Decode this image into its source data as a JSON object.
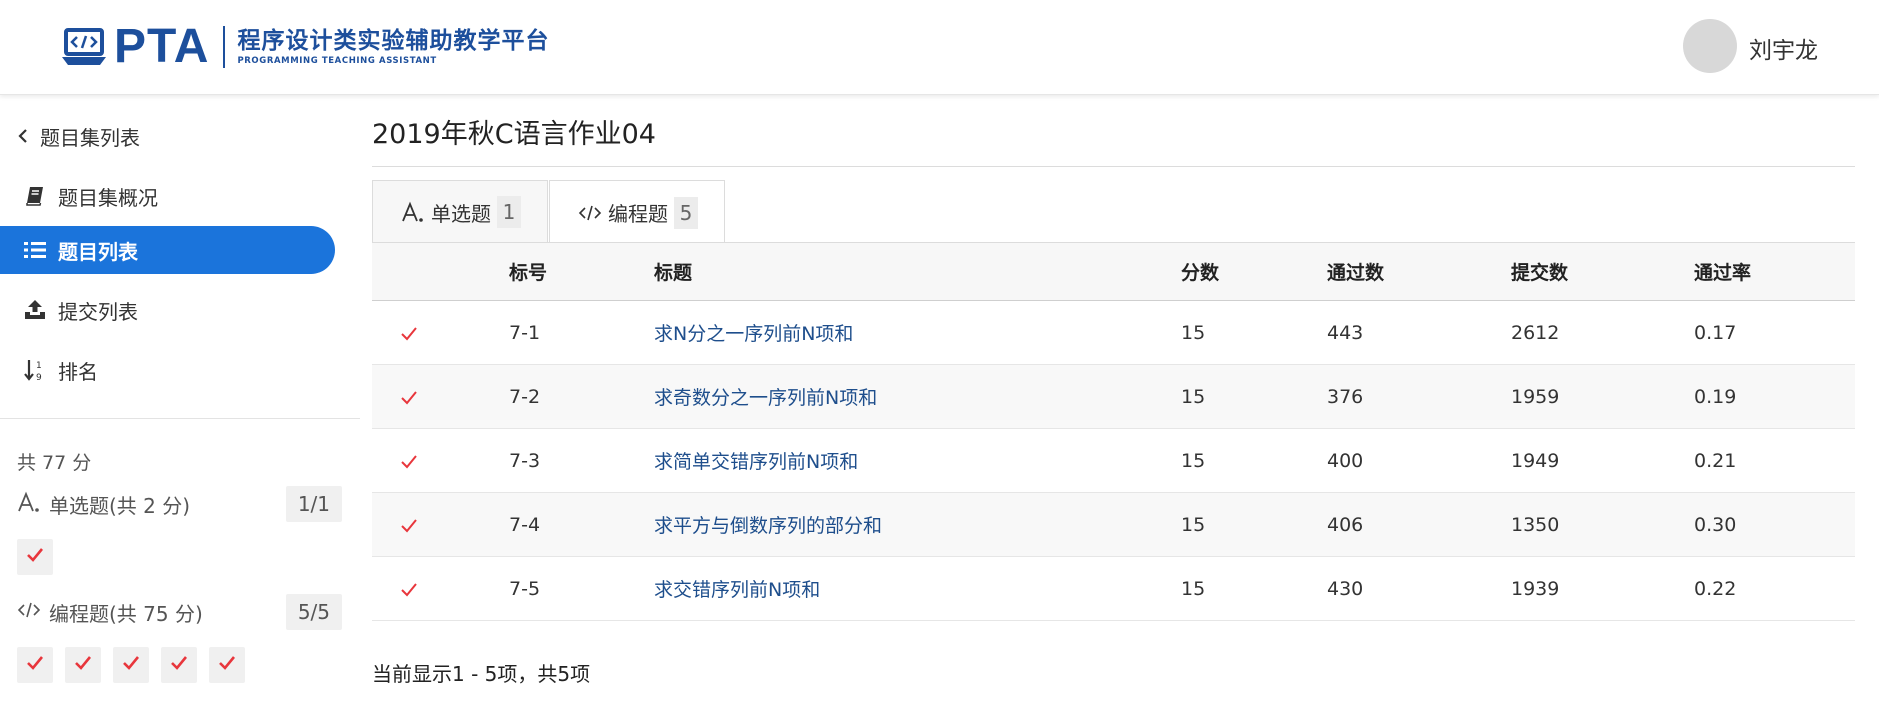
{
  "header": {
    "logo_mark": "PTA",
    "logo_cn": "程序设计类实验辅助教学平台",
    "logo_en": "PROGRAMMING TEACHING ASSISTANT",
    "username": "刘宇龙"
  },
  "sidebar": {
    "back_label": "题目集列表",
    "items": [
      {
        "label": "题目集概况",
        "icon": "book-icon"
      },
      {
        "label": "题目列表",
        "icon": "list-icon",
        "active": true
      },
      {
        "label": "提交列表",
        "icon": "upload-icon"
      },
      {
        "label": "排名",
        "icon": "sort-number-icon"
      }
    ],
    "total": "共 77 分",
    "sections": [
      {
        "label": "单选题(共 2 分)",
        "count": "1/1",
        "icon": "single-choice-icon"
      },
      {
        "label": "编程题(共 75 分)",
        "count": "5/5",
        "icon": "code-icon"
      }
    ]
  },
  "main": {
    "title": "2019年秋C语言作业04",
    "tabs": [
      {
        "label": "单选题",
        "count": "1",
        "icon": "single-choice-icon"
      },
      {
        "label": "编程题",
        "count": "5",
        "icon": "code-icon",
        "active": true
      }
    ],
    "columns": [
      "标号",
      "标题",
      "分数",
      "通过数",
      "提交数",
      "通过率"
    ],
    "rows": [
      {
        "no": "7-1",
        "title": "求N分之一序列前N项和",
        "score": "15",
        "pass": "443",
        "submit": "2612",
        "rate": "0.17"
      },
      {
        "no": "7-2",
        "title": "求奇数分之一序列前N项和",
        "score": "15",
        "pass": "376",
        "submit": "1959",
        "rate": "0.19"
      },
      {
        "no": "7-3",
        "title": "求简单交错序列前N项和",
        "score": "15",
        "pass": "400",
        "submit": "1949",
        "rate": "0.21"
      },
      {
        "no": "7-4",
        "title": "求平方与倒数序列的部分和",
        "score": "15",
        "pass": "406",
        "submit": "1350",
        "rate": "0.30"
      },
      {
        "no": "7-5",
        "title": "求交错序列前N项和",
        "score": "15",
        "pass": "430",
        "submit": "1939",
        "rate": "0.22"
      }
    ],
    "footer": "当前显示1 - 5项，共5项"
  },
  "colors": {
    "accent": "#1b74db",
    "brand": "#1d4f9c",
    "check": "#e8363c",
    "link": "#1e4e8c"
  }
}
